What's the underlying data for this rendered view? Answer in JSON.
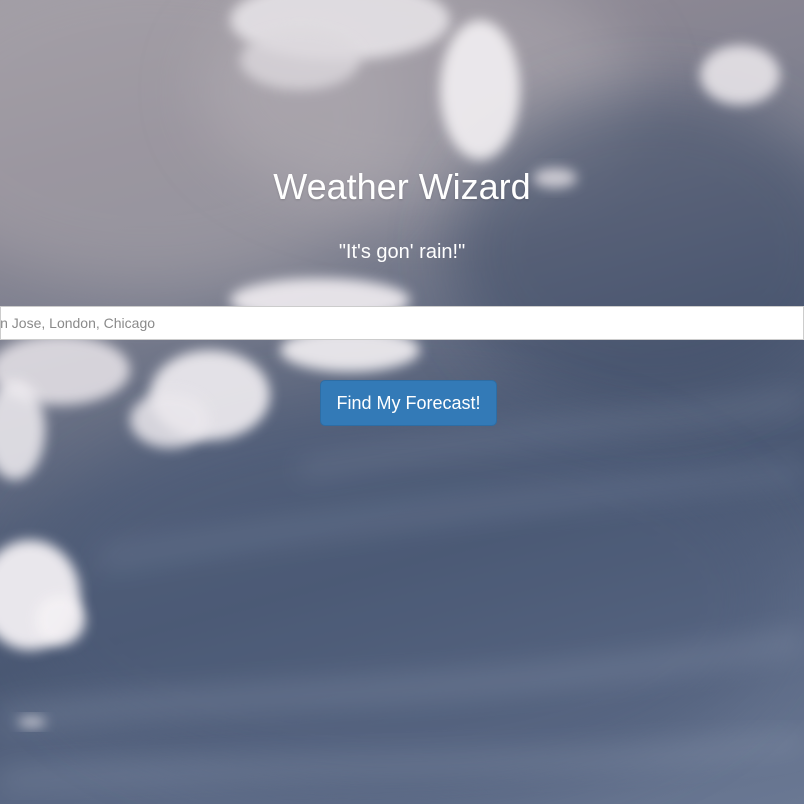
{
  "header": {
    "title": "Weather Wizard",
    "tagline": "\"It's gon' rain!\""
  },
  "search": {
    "placeholder": "San Jose, London, Chicago",
    "value": ""
  },
  "actions": {
    "submit_label": "Find My Forecast!"
  },
  "colors": {
    "button": "#337ab7",
    "button_border": "#2e6da4",
    "text": "#ffffff",
    "sky_dark": "#4a5873",
    "sky_light": "#9e9aa2"
  }
}
